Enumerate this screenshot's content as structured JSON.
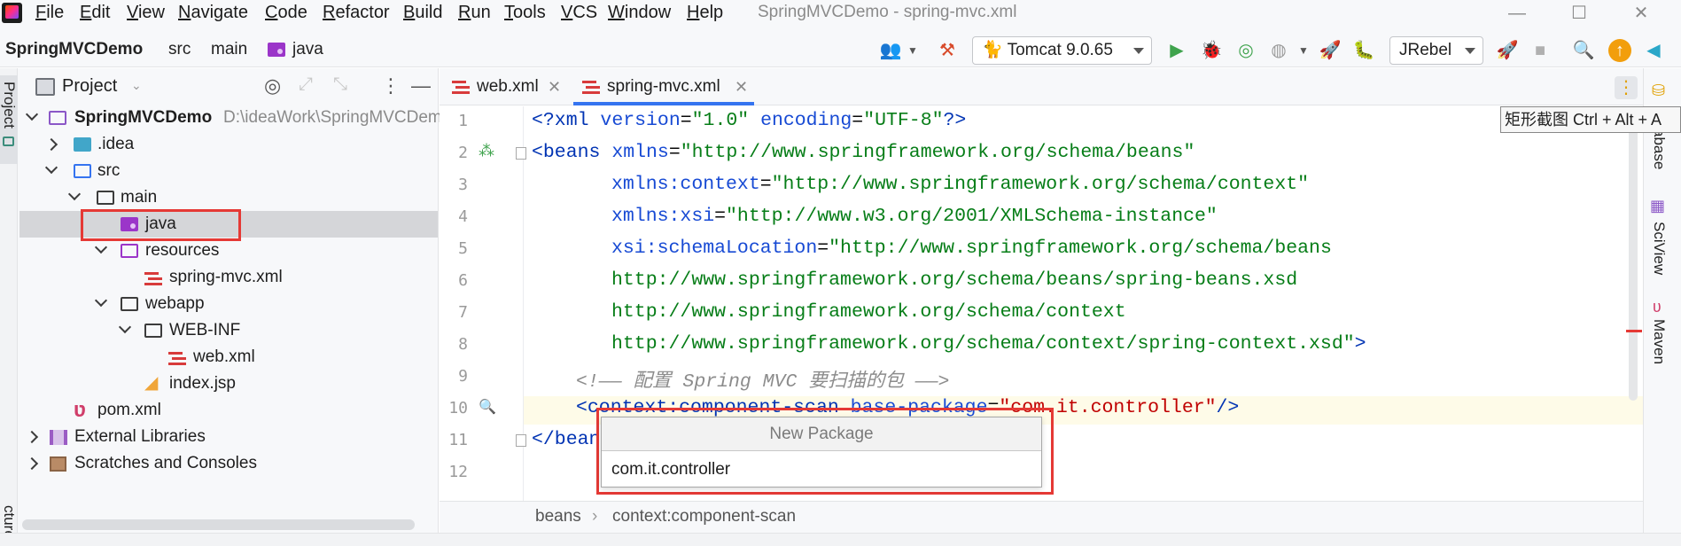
{
  "window": {
    "title": "SpringMVCDemo - spring-mvc.xml",
    "minimize": "—",
    "maximize": "☐",
    "close": "✕"
  },
  "menu": [
    "File",
    "Edit",
    "View",
    "Navigate",
    "Code",
    "Refactor",
    "Build",
    "Run",
    "Tools",
    "VCS",
    "Window",
    "Help"
  ],
  "nav": {
    "project": "SpringMVCDemo",
    "crumbs": [
      "src",
      "main",
      "java"
    ]
  },
  "toolbar": {
    "run_config": "Tomcat 9.0.65",
    "jrebel": "JRebel"
  },
  "left_strip": {
    "project_tab": "Project",
    "structure_tab": "cture"
  },
  "project_panel": {
    "title": "Project"
  },
  "tree": [
    {
      "label": "SpringMVCDemo",
      "hint": "D:\\ideaWork\\SpringMVCDem"
    },
    {
      "label": ".idea"
    },
    {
      "label": "src"
    },
    {
      "label": "main"
    },
    {
      "label": "java"
    },
    {
      "label": "resources"
    },
    {
      "label": "spring-mvc.xml"
    },
    {
      "label": "webapp"
    },
    {
      "label": "WEB-INF"
    },
    {
      "label": "web.xml"
    },
    {
      "label": "index.jsp"
    },
    {
      "label": "pom.xml"
    },
    {
      "label": "External Libraries"
    },
    {
      "label": "Scratches and Consoles"
    }
  ],
  "tabs": [
    {
      "label": "web.xml",
      "active": false
    },
    {
      "label": "spring-mvc.xml",
      "active": true
    }
  ],
  "editor": {
    "line_numbers": [
      "1",
      "2",
      "3",
      "4",
      "5",
      "6",
      "7",
      "8",
      "9",
      "10",
      "11",
      "12"
    ],
    "lines": {
      "l1_open": "<?xml ",
      "l1_attr1": "version",
      "l1_eq1": "=",
      "l1_val1": "\"1.0\"",
      "l1_attr2": " encoding",
      "l1_eq2": "=",
      "l1_val2": "\"UTF-8\"",
      "l1_close": "?>",
      "l2_tag": "<beans ",
      "l2_attr": "xmlns",
      "l2_eq": "=",
      "l2_val": "\"http://www.springframework.org/schema/beans\"",
      "l3_attr": "xmlns:context",
      "l3_eq": "=",
      "l3_val": "\"http://www.springframework.org/schema/context\"",
      "l4_attr": "xmlns:xsi",
      "l4_eq": "=",
      "l4_val": "\"http://www.w3.org/2001/XMLSchema-instance\"",
      "l5_attr": "xsi:schemaLocation",
      "l5_eq": "=",
      "l5_val": "\"http://www.springframework.org/schema/beans",
      "l6_val": "http://www.springframework.org/schema/beans/spring-beans.xsd",
      "l7_val": "http://www.springframework.org/schema/context",
      "l8_val": "http://www.springframework.org/schema/context/spring-context.xsd\"",
      "l8_close": ">",
      "l9_comment": "<!—— 配置 Spring MVC 要扫描的包 ——>",
      "l10_open": "<",
      "l10_tag": "context:component-scan ",
      "l10_attr": "base-package",
      "l10_eq": "=",
      "l10_val": "\"com.it.controller\"",
      "l10_close": "/>",
      "l11_tag": "</bean"
    }
  },
  "popup": {
    "title": "New Package",
    "value": "com.it.controller"
  },
  "breadcrumbs": [
    "beans",
    "context:component-scan"
  ],
  "tooltip": "矩形截图 Ctrl + Alt + A",
  "right_strip": [
    "abase",
    "SciView",
    "Maven"
  ],
  "colors": {
    "accent": "#3574f0",
    "highlight": "#e53935",
    "package": "#9b35c9",
    "xml_icon": "#d83b3b"
  }
}
